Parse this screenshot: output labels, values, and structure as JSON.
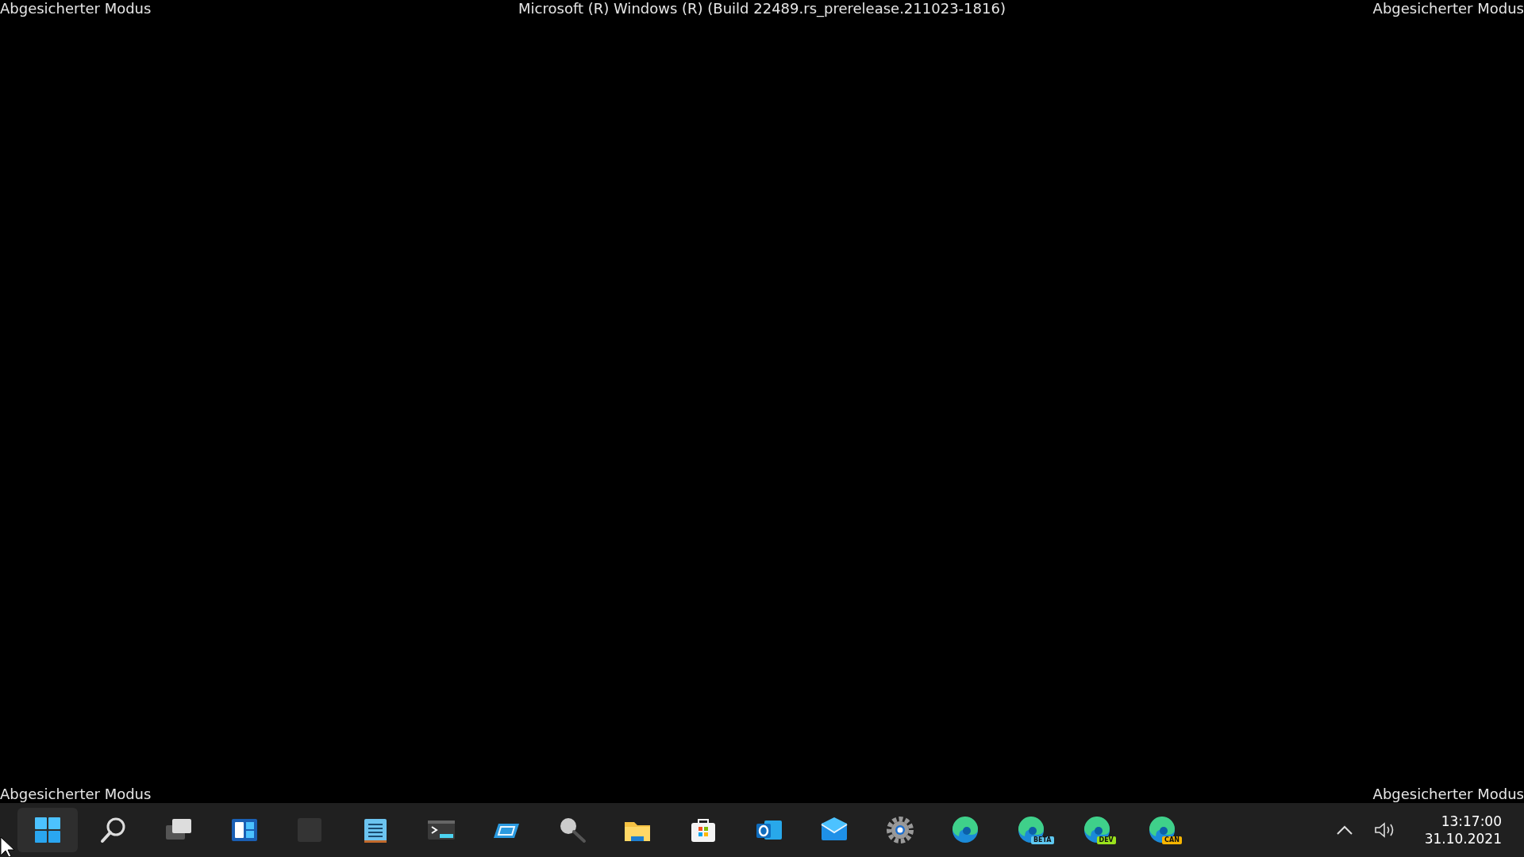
{
  "top_labels": {
    "left": "Abgesicherter Modus",
    "center": "Microsoft (R) Windows (R) (Build 22489.rs_prerelease.211023-1816)",
    "right": "Abgesicherter Modus"
  },
  "bottom_labels": {
    "left": "Abgesicherter Modus",
    "right": "Abgesicherter Modus"
  },
  "taskbar": {
    "items": [
      {
        "kind": "start",
        "selected": true
      },
      {
        "kind": "search",
        "selected": false
      },
      {
        "kind": "taskview",
        "selected": false
      },
      {
        "kind": "widgets",
        "selected": false
      },
      {
        "kind": "blank",
        "selected": false
      },
      {
        "kind": "notepad",
        "selected": false
      },
      {
        "kind": "terminal",
        "selected": false
      },
      {
        "kind": "tilted",
        "selected": false
      },
      {
        "kind": "magnifier",
        "selected": false
      },
      {
        "kind": "folder",
        "selected": false
      },
      {
        "kind": "store",
        "selected": false
      },
      {
        "kind": "outlook",
        "selected": false
      },
      {
        "kind": "mail",
        "selected": false
      },
      {
        "kind": "settings",
        "selected": false
      },
      {
        "kind": "edge",
        "selected": false
      },
      {
        "kind": "edge",
        "selected": false,
        "badge": "BETA",
        "color": "#5fc8f0"
      },
      {
        "kind": "edge",
        "selected": false,
        "badge": "DEV",
        "color": "#9be21d"
      },
      {
        "kind": "edge",
        "selected": false,
        "badge": "CAN",
        "color": "#f7b500"
      }
    ],
    "tray": {
      "time": "13:17:00",
      "date": "31.10.2021"
    }
  }
}
